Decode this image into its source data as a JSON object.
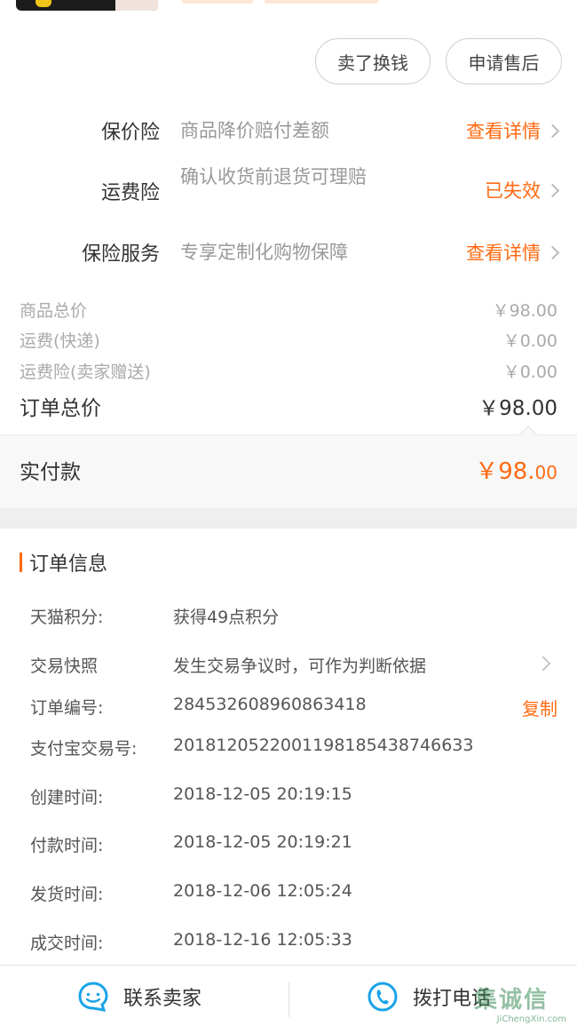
{
  "actions": {
    "sell_label": "卖了换钱",
    "aftersale_label": "申请售后"
  },
  "insurance": [
    {
      "label": "保价险",
      "desc": "商品降价赔付差额",
      "action": "查看详情"
    },
    {
      "label": "运费险",
      "desc": "确认收货前退货可理赔",
      "action": "已失效"
    },
    {
      "label": "保险服务",
      "desc": "专享定制化购物保障",
      "action": "查看详情"
    }
  ],
  "prices": {
    "goods_total_label": "商品总价",
    "goods_total_value": "￥98.00",
    "shipping_label": "运费(快递)",
    "shipping_value": "￥0.00",
    "shipping_ins_label": "运费险(卖家赠送)",
    "shipping_ins_value": "￥0.00",
    "order_total_label": "订单总价",
    "order_total_value": "￥98.00",
    "paid_label": "实付款",
    "paid_int": "￥98.",
    "paid_dec": "00"
  },
  "order_info": {
    "title": "订单信息",
    "rows": [
      {
        "key": "天猫积分:",
        "value": "获得49点积分",
        "action": ""
      },
      {
        "key": "交易快照",
        "value": "发生交易争议时，可作为判断依据",
        "action": ""
      },
      {
        "key": "订单编号:",
        "value": "284532608960863418",
        "action": "复制"
      },
      {
        "key": "支付宝交易号:",
        "value": "2018120522001198185438746633",
        "action": ""
      },
      {
        "key": "创建时间:",
        "value": "2018-12-05 20:19:15",
        "action": ""
      },
      {
        "key": "付款时间:",
        "value": "2018-12-05 20:19:21",
        "action": ""
      },
      {
        "key": "发货时间:",
        "value": "2018-12-06 12:05:24",
        "action": ""
      },
      {
        "key": "成交时间:",
        "value": "2018-12-16 12:05:33",
        "action": ""
      }
    ]
  },
  "bottom_bar": {
    "contact_seller": "联系卖家",
    "call_phone": "拨打电话"
  },
  "watermark": {
    "text": "集诚信",
    "sub": "JiChengXin.com"
  },
  "colors": {
    "accent": "#ff6a12",
    "icon_blue": "#1aa3e8"
  }
}
